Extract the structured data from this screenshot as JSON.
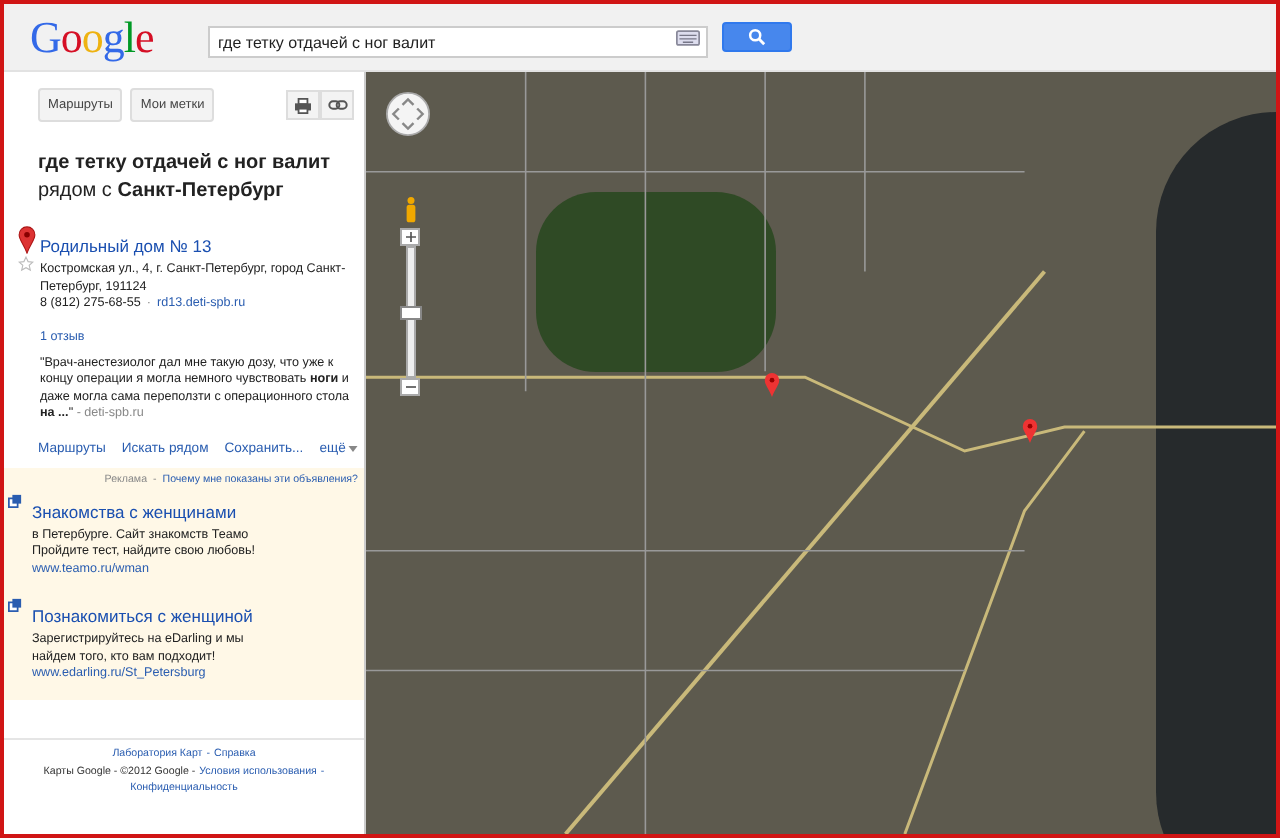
{
  "header": {
    "logo": "Google",
    "search": {
      "value": "где тетку отдачей с ног валит"
    }
  },
  "toolbar": {
    "buttons": [
      "Маршруты",
      "Мои метки"
    ]
  },
  "results": {
    "headline": "где тетку отдачей с ног валит",
    "headline_near": "рядом с **Санкт-Петербург**",
    "place": {
      "title": "Родильный дом № 13",
      "address": "Костромская ул., 4, г. Санкт-Петербург, город Санкт-Петербург, 191124",
      "phone": "8 (812) 275-68-55",
      "site_separator": "·",
      "site": "rd13.deti-spb.ru",
      "reviews": "1 отзыв",
      "quote": "\"Врач-анестезиолог дал мне такую дозу, что уже к концу операции я могла немного чувствовать **ноги** и даже могла сама переползти с операционного стола **на ...**\"",
      "quote_source": "- deti-spb.ru"
    },
    "actions": [
      "Маршруты",
      "Искать рядом",
      "Сохранить...",
      "ещё"
    ]
  },
  "ads": {
    "label": "Реклама",
    "separator": "-",
    "why": "Почему мне показаны эти объявления?",
    "items": [
      {
        "title": "Знакомства с женщинами",
        "lines": [
          "в Петербурге. Сайт знакомств Теамо",
          "Пройдите тест, найдите свою любовь!"
        ],
        "url": "www.teamo.ru/wman"
      },
      {
        "title": "Познакомиться с женщиной",
        "lines": [
          "Зарегистрируйтесь на eDarling и мы",
          "найдем того, кто вам подходит!"
        ],
        "url": "www.edarling.ru/St_Petersburg"
      }
    ]
  },
  "footer": {
    "links": [
      "Лаборатория Карт",
      "Справка"
    ],
    "separator": "-",
    "copyright": "Карты Google - ©2012 Google -",
    "legal_links": [
      "Условия использования",
      "Конфиденциальность"
    ]
  },
  "map": {
    "zoom": {
      "level": 0.5
    }
  }
}
